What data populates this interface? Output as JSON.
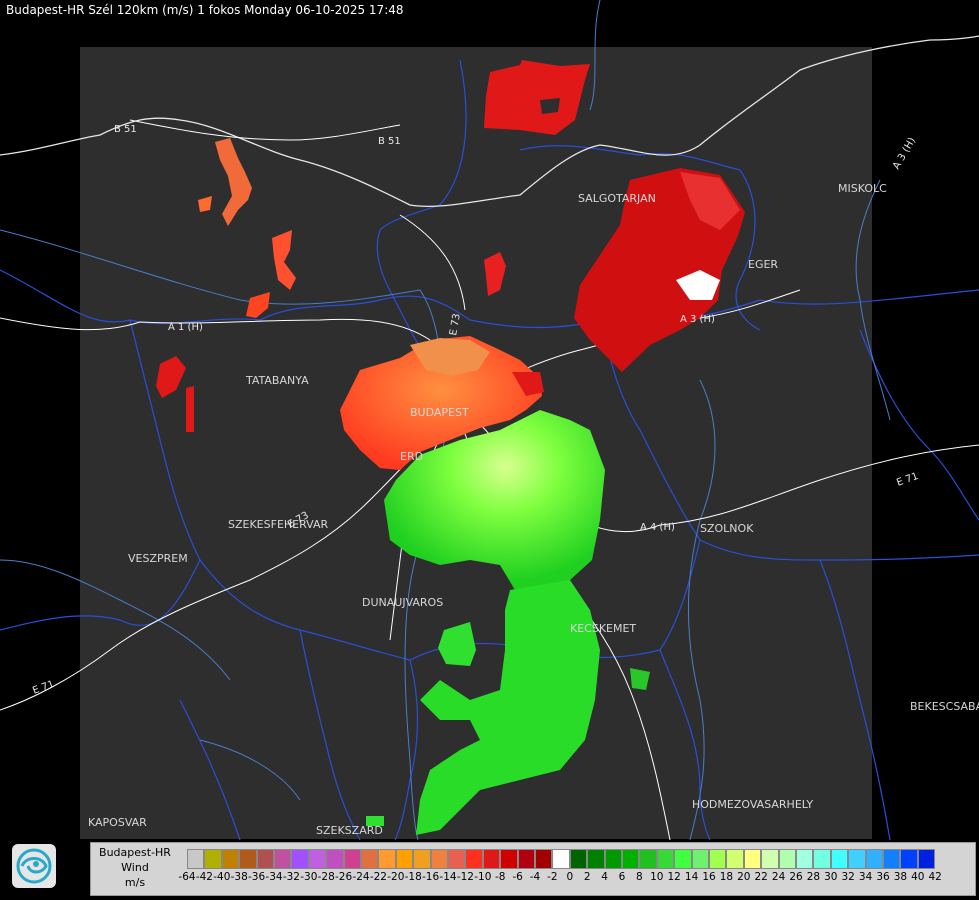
{
  "header": {
    "title": "Budapest-HR Szél 120km (m/s) 1 fokos Monday 06-10-2025 17:48"
  },
  "cities": [
    {
      "name": "SALGOTARJAN"
    },
    {
      "name": "MISKOLC"
    },
    {
      "name": "EGER"
    },
    {
      "name": "TATABANYA"
    },
    {
      "name": "BUDAPEST"
    },
    {
      "name": "ERD"
    },
    {
      "name": "SZEKESFEHERVAR"
    },
    {
      "name": "VESZPREM"
    },
    {
      "name": "DUNAUJVAROS"
    },
    {
      "name": "KECSKEMET"
    },
    {
      "name": "SZOLNOK"
    },
    {
      "name": "BEKESCSABA"
    },
    {
      "name": "HODMEZOVASARHELY"
    },
    {
      "name": "KAPOSVAR"
    },
    {
      "name": "SZEKSZARD"
    }
  ],
  "roads": [
    {
      "name": "B 51"
    },
    {
      "name": "B 51"
    },
    {
      "name": "A 1 (H)"
    },
    {
      "name": "A 3 (H)"
    },
    {
      "name": "A 3 (H)"
    },
    {
      "name": "A 4 (H)"
    },
    {
      "name": "E 71"
    },
    {
      "name": "E 73"
    },
    {
      "name": "E 71"
    },
    {
      "name": "E 73"
    }
  ],
  "legend": {
    "station": "Budapest-HR",
    "quantity": "Wind",
    "unit": "m/s",
    "ticks": [
      "-64",
      "-42",
      "-40",
      "-38",
      "-36",
      "-34",
      "-32",
      "-30",
      "-28",
      "-26",
      "-24",
      "-22",
      "-20",
      "-18",
      "-16",
      "-14",
      "-12",
      "-10",
      "-8",
      "-6",
      "-4",
      "-2",
      "0",
      "2",
      "4",
      "6",
      "8",
      "10",
      "12",
      "14",
      "16",
      "18",
      "20",
      "22",
      "24",
      "26",
      "28",
      "30",
      "32",
      "34",
      "36",
      "38",
      "40",
      "42"
    ],
    "colors": [
      "#c8c8c8",
      "#b0b000",
      "#c08000",
      "#b05a1c",
      "#b05050",
      "#c050a0",
      "#a050ff",
      "#c060e0",
      "#c050c0",
      "#d04090",
      "#e07040",
      "#ff9a30",
      "#ffa000",
      "#f0a020",
      "#f08040",
      "#e86050",
      "#ff3020",
      "#e01818",
      "#d00000",
      "#b00010",
      "#a00000",
      "#ffffff",
      "#006400",
      "#008000",
      "#009a00",
      "#00b000",
      "#20c020",
      "#38d838",
      "#40ff40",
      "#70f070",
      "#a0ff50",
      "#d0ff70",
      "#ffff80",
      "#d0ffb0",
      "#b0ffb0",
      "#a0ffe0",
      "#70ffe0",
      "#40ffff",
      "#40d0ff",
      "#30b0ff",
      "#1080ff",
      "#0040ff",
      "#0020e0"
    ]
  }
}
